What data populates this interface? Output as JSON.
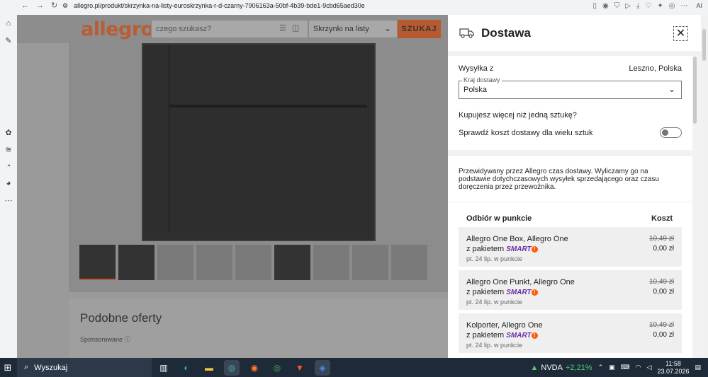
{
  "browser": {
    "url": "allegro.pl/produkt/skrzynka-na-listy-euroskrzynka-r-d-czarny-7906163a-50bf-4b39-bde1-9cbd65aed30e",
    "ai_label": "AI"
  },
  "site": {
    "logo": "allegro",
    "search_placeholder": "czego szukasz?",
    "category": "Skrzynki na listy",
    "search_button": "SZUKAJ"
  },
  "similar": {
    "title": "Podobne oferty",
    "sponsored": "Sponsorowane"
  },
  "panel": {
    "title": "Dostawa",
    "ship_from_label": "Wysyłka z",
    "ship_from_value": "Leszno, Polska",
    "country_label": "Kraj dostawy",
    "country_value": "Polska",
    "more_items_q": "Kupujesz więcej niż jedną sztukę?",
    "check_cost": "Sprawdź koszt dostawy dla wielu sztuk",
    "toggle_on": false,
    "info": "Przewidywany przez Allegro czas dostawy. Wyliczamy go na podstawie dotychczasowych wysyłek sprzedającego oraz czasu doręczenia przez przewoźnika.",
    "table_head_left": "Odbiór w punkcie",
    "table_head_right": "Koszt",
    "options": [
      {
        "name": "Allegro One Box, Allegro One",
        "pkg": "z pakietem",
        "smart": "SMART",
        "date": "pt. 24 lip. w punkcie",
        "old": "10,49 zł",
        "new": "0,00 zł"
      },
      {
        "name": "Allegro One Punkt, Allegro One",
        "pkg": "z pakietem",
        "smart": "SMART",
        "date": "pt. 24 lip. w punkcie",
        "old": "10,49 zł",
        "new": "0,00 zł"
      },
      {
        "name": "Kolporter, Allegro One",
        "pkg": "z pakietem",
        "smart": "SMART",
        "date": "pt. 24 lip. w punkcie",
        "old": "10,49 zł",
        "new": "0,00 zł"
      }
    ]
  },
  "taskbar": {
    "search": "Wyszukaj",
    "stock_name": "NVDA",
    "stock_change": "+2,21%",
    "time": "11:58",
    "date": "23.07.2026"
  }
}
